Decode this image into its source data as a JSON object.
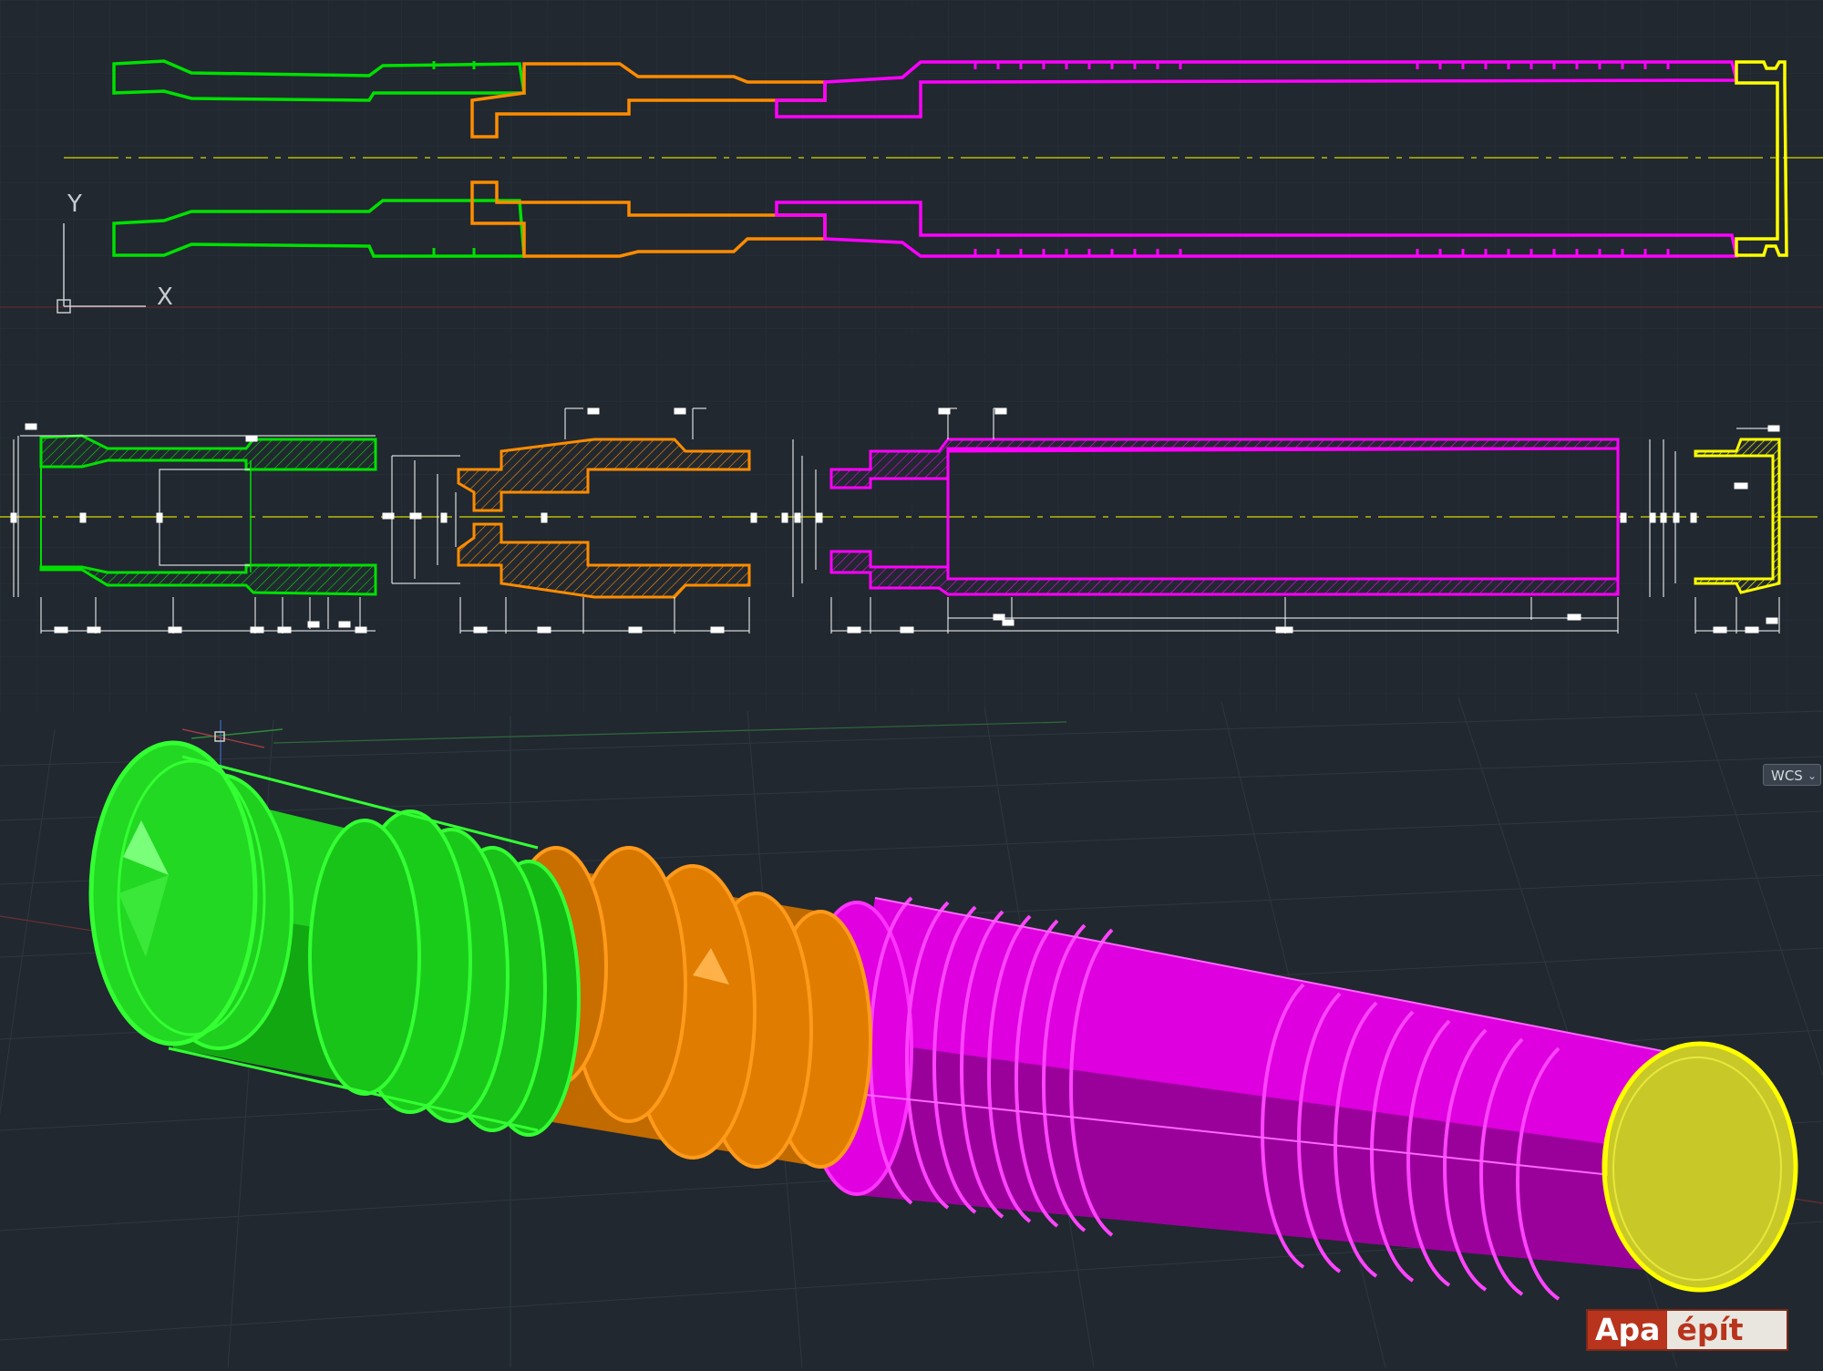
{
  "app": {
    "canvas_bg": "#212830",
    "ucs": {
      "x_label": "X",
      "y_label": "Y"
    },
    "view_cube": {
      "label": "WCS",
      "chevron": "chevron-down-icon"
    }
  },
  "parts": [
    {
      "name": "green-part",
      "color": "#00e000"
    },
    {
      "name": "orange-part",
      "color": "#ff8c00"
    },
    {
      "name": "magenta-part",
      "color": "#ff00ff"
    },
    {
      "name": "yellow-part",
      "color": "#ffff00"
    }
  ],
  "colors": {
    "green": "#00e000",
    "green_fill": "#1fd01f",
    "orange": "#ff8c00",
    "orange_fill": "#e07d00",
    "magenta": "#ff00ff",
    "magenta_fill": "#d400d4",
    "yellow": "#ffff00",
    "yellow_fill": "#c8c829",
    "centerline": "#d8d800",
    "dimension": "#ffffff",
    "grid": "#2d3640"
  },
  "watermark": {
    "part1": "Apa",
    "part2": "épít"
  }
}
